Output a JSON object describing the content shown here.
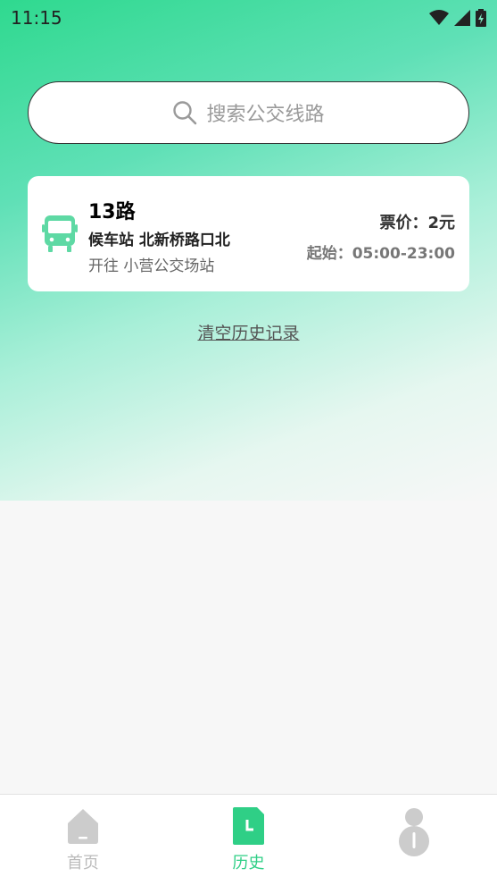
{
  "status": {
    "time": "11:15"
  },
  "search": {
    "placeholder": "搜索公交线路"
  },
  "route": {
    "name": "13路",
    "stop": "候车站 北新桥路口北",
    "destination": "开往 小营公交场站",
    "fare": "票价：2元",
    "hours": "起始：05:00-23:00"
  },
  "actions": {
    "clear_history": "清空历史记录"
  },
  "nav": {
    "items": [
      {
        "label": "首页",
        "icon": "home-icon",
        "active": false
      },
      {
        "label": "历史",
        "icon": "history-icon",
        "active": true
      },
      {
        "label": "",
        "icon": "profile-icon",
        "active": false
      }
    ]
  },
  "colors": {
    "accent": "#2fcf86",
    "inactive": "#cccccc"
  }
}
